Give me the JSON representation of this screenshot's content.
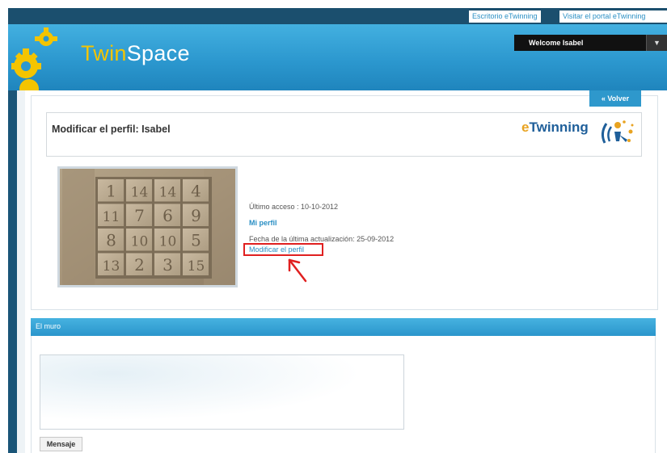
{
  "topbar": {
    "link_escritorio": "Escritorio eTwinning",
    "link_portal": "Visitar el portal eTwinning"
  },
  "header": {
    "brand_twin": "Twin",
    "brand_space": "Space",
    "welcome": "Welcome Isabel",
    "colors": {
      "header_blue": "#2c98cf",
      "brand_yellow": "#f4c400",
      "rail_navy": "#1a5578"
    }
  },
  "profile": {
    "back_button": "« Volver",
    "title": "Modificar el perfil: Isabel",
    "etwinning_logo_text": "eTwinning",
    "photo_numbers": [
      [
        "1",
        "14",
        "14",
        "4"
      ],
      [
        "11",
        "7",
        "6",
        "9"
      ],
      [
        "8",
        "10",
        "10",
        "5"
      ],
      [
        "13",
        "2",
        "3",
        "15"
      ]
    ],
    "last_access": "Último acceso : 10-10-2012",
    "my_profile_link": "Mi perfil",
    "last_update": "Fecha de la última actualización: 25-09-2012",
    "edit_profile_link": "Modificar el perfil"
  },
  "wall": {
    "title": "El muro",
    "message_button": "Mensaje"
  }
}
